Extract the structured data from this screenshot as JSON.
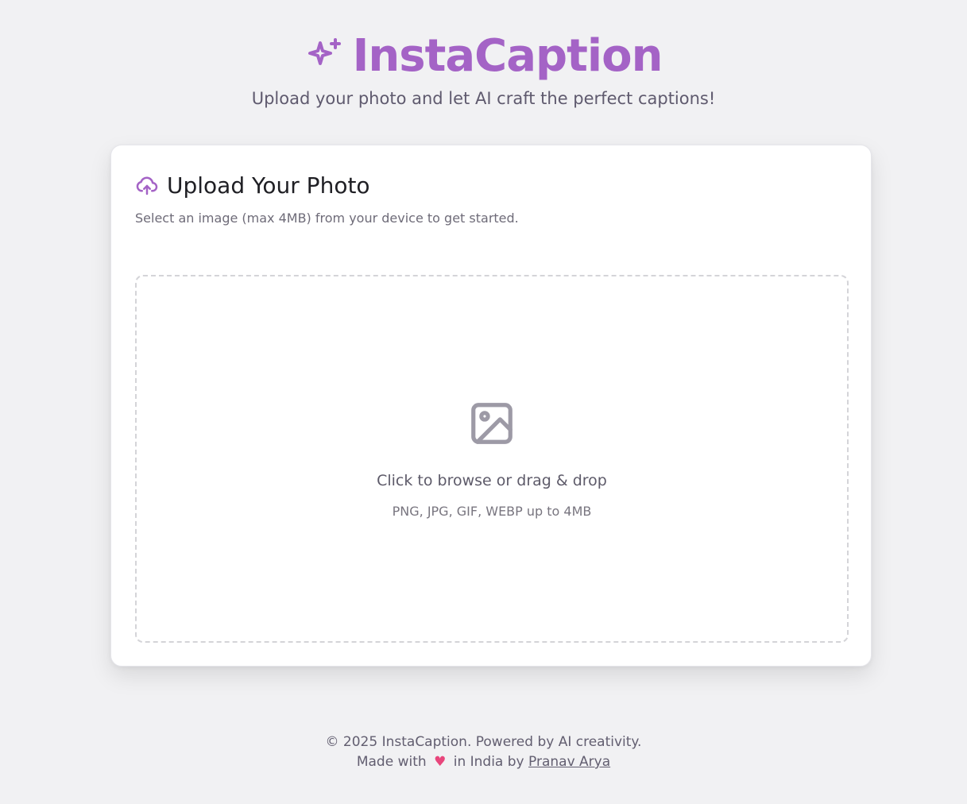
{
  "header": {
    "title": "InstaCaption",
    "subtitle": "Upload your photo and let AI craft the perfect captions!",
    "icon": "sparkles-icon"
  },
  "card": {
    "icon": "cloud-upload-icon",
    "title": "Upload Your Photo",
    "description": "Select an image (max 4MB) from your device to get started."
  },
  "dropzone": {
    "icon": "image-icon",
    "main_text": "Click to browse or drag & drop",
    "sub_text": "PNG, JPG, GIF, WEBP up to 4MB"
  },
  "footer": {
    "line1": "© 2025 InstaCaption. Powered by AI creativity.",
    "made_with": "Made with",
    "heart": "♥",
    "in_india_by": "in India by",
    "author": "Pranav Arya"
  },
  "colors": {
    "accent": "#a463c6",
    "background": "#f1f1f3",
    "card": "#ffffff",
    "heart": "#e8467c"
  }
}
